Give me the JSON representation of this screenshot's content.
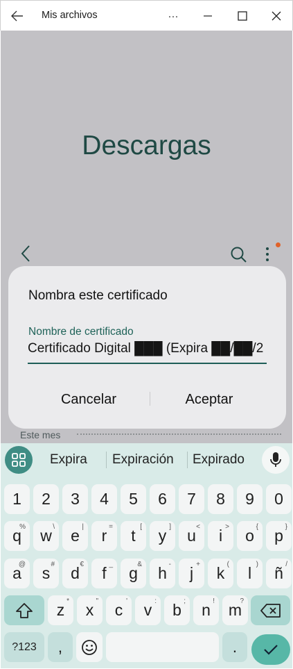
{
  "window": {
    "title": "Mis archivos",
    "more_label": "···"
  },
  "app": {
    "folder_title": "Descargas",
    "section_label": "Este mes",
    "colors": {
      "accent": "#1f4944",
      "notification_dot": "#e0622a"
    }
  },
  "dialog": {
    "title": "Nombra este certificado",
    "field_label": "Nombre de certificado",
    "field_value": "Certificado Digital ███ (Expira ██/██/2",
    "cancel_label": "Cancelar",
    "accept_label": "Aceptar"
  },
  "keyboard": {
    "suggestions": [
      "Expira",
      "Expiración",
      "Expirado"
    ],
    "number_row": [
      "1",
      "2",
      "3",
      "4",
      "5",
      "6",
      "7",
      "8",
      "9",
      "0"
    ],
    "row1": [
      {
        "k": "q",
        "s": "%"
      },
      {
        "k": "w",
        "s": "\\"
      },
      {
        "k": "e",
        "s": "|"
      },
      {
        "k": "r",
        "s": "="
      },
      {
        "k": "t",
        "s": "["
      },
      {
        "k": "y",
        "s": "]"
      },
      {
        "k": "u",
        "s": "<"
      },
      {
        "k": "i",
        "s": ">"
      },
      {
        "k": "o",
        "s": "{"
      },
      {
        "k": "p",
        "s": "}"
      }
    ],
    "row2": [
      {
        "k": "a",
        "s": "@"
      },
      {
        "k": "s",
        "s": "#"
      },
      {
        "k": "d",
        "s": "€"
      },
      {
        "k": "f",
        "s": "_"
      },
      {
        "k": "g",
        "s": "&"
      },
      {
        "k": "h",
        "s": "-"
      },
      {
        "k": "j",
        "s": "+"
      },
      {
        "k": "k",
        "s": "("
      },
      {
        "k": "l",
        "s": ")"
      },
      {
        "k": "ñ",
        "s": "/"
      }
    ],
    "row3": [
      {
        "k": "z",
        "s": "*"
      },
      {
        "k": "x",
        "s": "\""
      },
      {
        "k": "c",
        "s": "'"
      },
      {
        "k": "v",
        "s": ":"
      },
      {
        "k": "b",
        "s": ";"
      },
      {
        "k": "n",
        "s": "!"
      },
      {
        "k": "m",
        "s": "?"
      }
    ],
    "symbols_label": "?123",
    "comma_label": ",",
    "period_label": "."
  }
}
